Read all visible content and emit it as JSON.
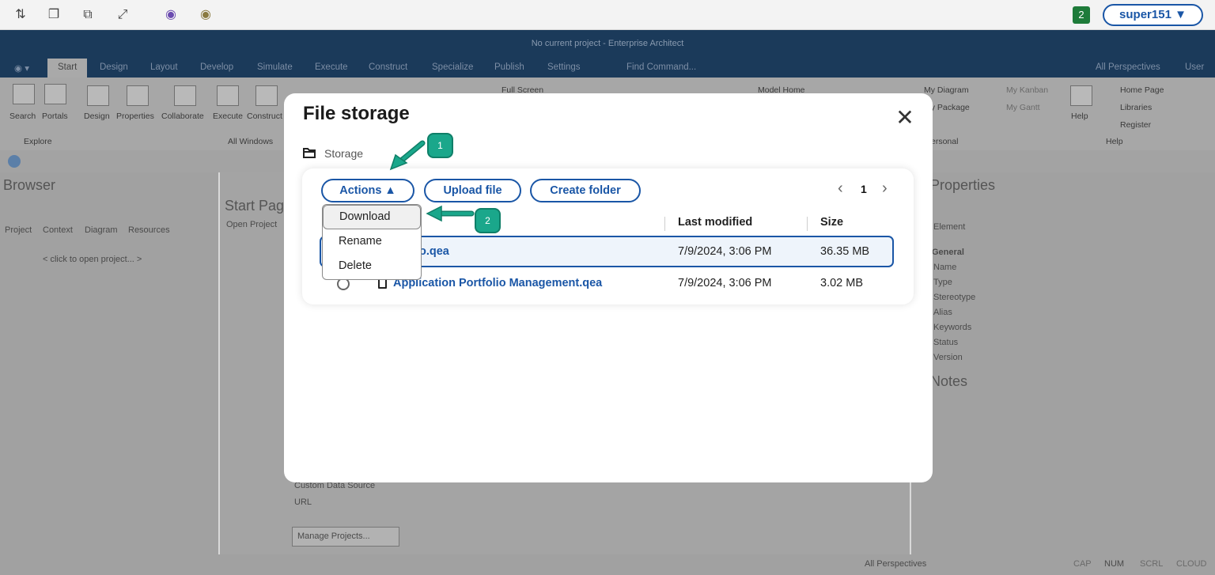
{
  "remote_bar": {
    "badge_count": "2",
    "user": "super151 ▼"
  },
  "app": {
    "window_title": "No current project - Enterprise Architect",
    "ribbon_tabs": [
      "Start",
      "Design",
      "Layout",
      "Develop",
      "Simulate",
      "Execute",
      "Construct",
      "Specialize",
      "Publish",
      "Settings"
    ],
    "find_command": "Find Command...",
    "perspectives": "All Perspectives",
    "user_menu": "User",
    "ribbon_buttons": [
      "Search",
      "Portals",
      "Design",
      "Properties",
      "Collaborate",
      "Execute",
      "Construct"
    ],
    "ribbon_groups": [
      "Explore",
      "All Windows",
      "Personal",
      "Help"
    ],
    "full_screen": "Full Screen",
    "model_home": "Model Home",
    "my_diagram": "My Diagram",
    "my_package": "My Package",
    "my_kanban": "My Kanban",
    "my_gantt": "My Gantt",
    "help": "Help",
    "home_page": "Home Page",
    "libraries": "Libraries",
    "register": "Register",
    "browser": {
      "title": "Browser",
      "tabs": [
        "Project",
        "Context",
        "Diagram",
        "Resources"
      ],
      "open_hint": "< click to open project... >"
    },
    "start_page": {
      "title": "Start Page",
      "tab": "Open Project",
      "custom_source": "Custom Data Source",
      "url": "URL",
      "manage": "Manage Projects..."
    },
    "properties": {
      "title": "Properties",
      "element": "Element",
      "group": "General",
      "fields": [
        "Name",
        "Type",
        "Stereotype",
        "Alias",
        "Keywords",
        "Status",
        "Version"
      ]
    },
    "notes": {
      "title": "Notes"
    },
    "status": {
      "perspectives": "All Perspectives",
      "flags": [
        "CAP",
        "NUM",
        "SCRL",
        "CLOUD"
      ]
    }
  },
  "modal": {
    "title": "File storage",
    "close_glyph": "✕",
    "breadcrumb": "Storage",
    "actions_label": "Actions ▲",
    "upload_label": "Upload file",
    "create_folder_label": "Create folder",
    "pager": {
      "prev": "‹",
      "page": "1",
      "next": "›"
    },
    "columns": [
      "Last modified",
      "Size"
    ],
    "files": [
      {
        "name": "o.qea",
        "modified": "7/9/2024, 3:06 PM",
        "size": "36.35 MB",
        "selected": true
      },
      {
        "name": "Application Portfolio Management.qea",
        "modified": "7/9/2024, 3:06 PM",
        "size": "3.02 MB",
        "selected": false
      }
    ],
    "menu": [
      "Download",
      "Rename",
      "Delete"
    ]
  },
  "callouts": [
    "1",
    "2"
  ],
  "colors": {
    "accent": "#1a56a6",
    "callout": "#1aa78b",
    "app_title": "#1b3a5a"
  }
}
